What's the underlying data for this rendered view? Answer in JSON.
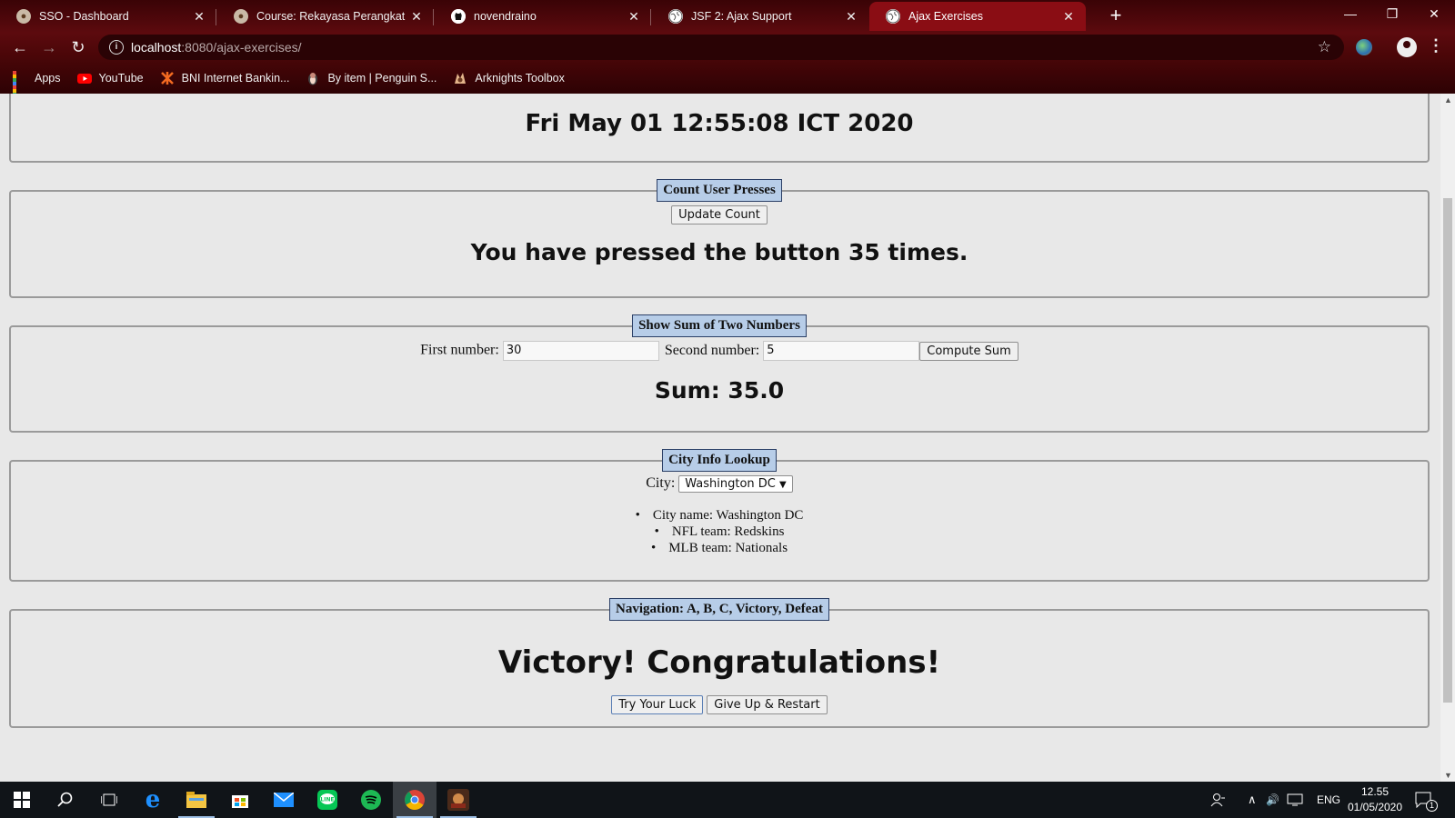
{
  "browser": {
    "tabs": [
      {
        "title": "SSO - Dashboard",
        "icon": "seal-icon",
        "active": false
      },
      {
        "title": "Course: Rekayasa Perangkat Luna",
        "icon": "seal-icon",
        "active": false
      },
      {
        "title": "novendraino",
        "icon": "github-icon",
        "active": false
      },
      {
        "title": "JSF 2: Ajax Support",
        "icon": "globe-icon",
        "active": false
      },
      {
        "title": "Ajax Exercises",
        "icon": "globe-icon",
        "active": true
      }
    ],
    "url_host": "localhost",
    "url_path": ":8080/ajax-exercises/",
    "bookmarks": [
      {
        "label": "Apps",
        "icon": "apps-grid-icon"
      },
      {
        "label": "YouTube",
        "icon": "youtube-icon"
      },
      {
        "label": "BNI Internet Bankin...",
        "icon": "bni-icon"
      },
      {
        "label": "By item | Penguin S...",
        "icon": "penguin-icon"
      },
      {
        "label": "Arknights Toolbox",
        "icon": "arknights-icon"
      }
    ],
    "theme_color": "#8a0d14"
  },
  "page": {
    "datetime": "Fri May 01 12:55:08 ICT 2020",
    "count_section": {
      "legend": "Count User Presses",
      "button": "Update Count",
      "message": "You have pressed the button 35 times."
    },
    "sum_section": {
      "legend": "Show Sum of Two Numbers",
      "first_label": "First number:",
      "first_value": "30",
      "second_label": "Second number:",
      "second_value": "5",
      "button": "Compute Sum",
      "result": "Sum: 35.0"
    },
    "city_section": {
      "legend": "City Info Lookup",
      "city_label": "City:",
      "city_selected": "Washington DC",
      "info": [
        "City name: Washington DC",
        "NFL team: Redskins",
        "MLB team: Nationals"
      ]
    },
    "nav_section": {
      "legend": "Navigation: A, B, C, Victory, Defeat",
      "message": "Victory! Congratulations!",
      "try_button": "Try Your Luck",
      "restart_button": "Give Up & Restart"
    },
    "legend_color": "#b7cde8"
  },
  "taskbar": {
    "language": "ENG",
    "time": "12.55",
    "date": "01/05/2020",
    "notification_count": "1"
  }
}
